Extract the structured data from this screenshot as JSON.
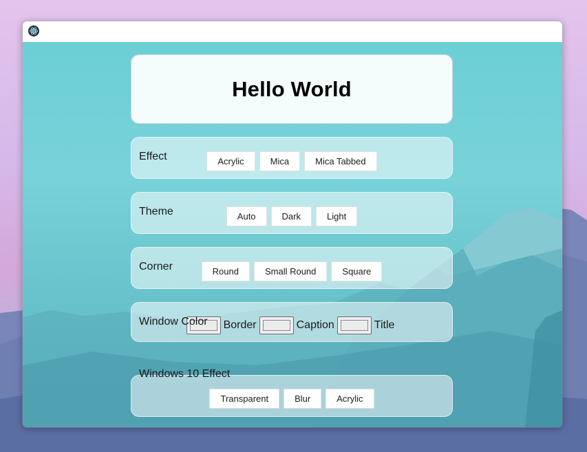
{
  "window": {
    "icon": "electron-atom-icon"
  },
  "hero": {
    "title": "Hello World"
  },
  "effect": {
    "legend": "Effect",
    "buttons": [
      "Acrylic",
      "Mica",
      "Mica Tabbed"
    ]
  },
  "theme": {
    "legend": "Theme",
    "buttons": [
      "Auto",
      "Dark",
      "Light"
    ]
  },
  "corner": {
    "legend": "Corner",
    "buttons": [
      "Round",
      "Small Round",
      "Square"
    ]
  },
  "window_color": {
    "legend": "Window Color",
    "labels": [
      "Border",
      "Caption",
      "Title"
    ],
    "swatch_color": "#ececec"
  },
  "win10_effect": {
    "legend": "Windows 10 Effect",
    "buttons": [
      "Transparent",
      "Blur",
      "Acrylic"
    ]
  },
  "colors": {
    "accent_teal": "#6ccfd6",
    "titlebar": "#ffffff"
  }
}
